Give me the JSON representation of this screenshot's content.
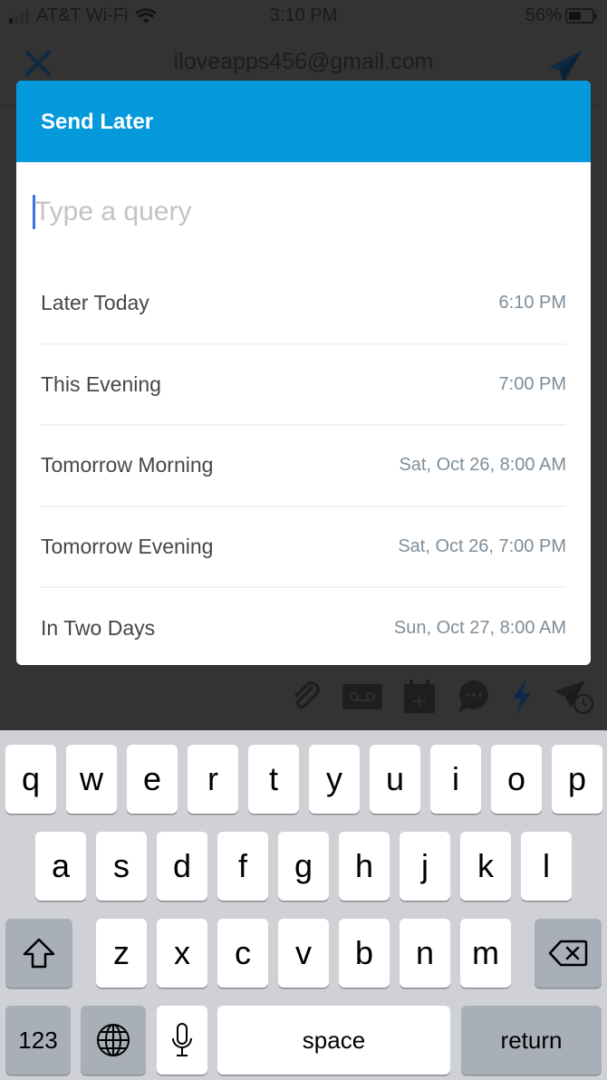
{
  "status_bar": {
    "carrier": "AT&T Wi-Fi",
    "time": "3:10 PM",
    "battery_percent": "56%",
    "battery_level": 0.56,
    "signal_bars_active": 1,
    "signal_bars_total": 4
  },
  "app_header": {
    "close_icon": "close-x-icon",
    "email": "iloveapps456@gmail.com",
    "send_icon": "paper-plane-icon"
  },
  "dialog": {
    "title": "Send Later",
    "accent_color": "#0399db",
    "query": {
      "value": "",
      "placeholder": "Type a query"
    },
    "options": [
      {
        "label": "Later Today",
        "time": "6:10 PM"
      },
      {
        "label": "This Evening",
        "time": "7:00 PM"
      },
      {
        "label": "Tomorrow Morning",
        "time": "Sat, Oct 26, 8:00 AM"
      },
      {
        "label": "Tomorrow Evening",
        "time": "Sat, Oct 26, 7:00 PM"
      },
      {
        "label": "In Two Days",
        "time": "Sun, Oct 27, 8:00 AM"
      }
    ]
  },
  "compose_toolbar": {
    "icons": [
      "paperclip-icon",
      "voicemail-icon",
      "calendar-add-icon",
      "chat-bubble-icon",
      "lightning-icon",
      "send-later-icon"
    ]
  },
  "keyboard": {
    "row1": [
      "q",
      "w",
      "e",
      "r",
      "t",
      "y",
      "u",
      "i",
      "o",
      "p"
    ],
    "row2": [
      "a",
      "s",
      "d",
      "f",
      "g",
      "h",
      "j",
      "k",
      "l"
    ],
    "row3": [
      "z",
      "x",
      "c",
      "v",
      "b",
      "n",
      "m"
    ],
    "numbers_label": "123",
    "space_label": "space",
    "return_label": "return"
  }
}
